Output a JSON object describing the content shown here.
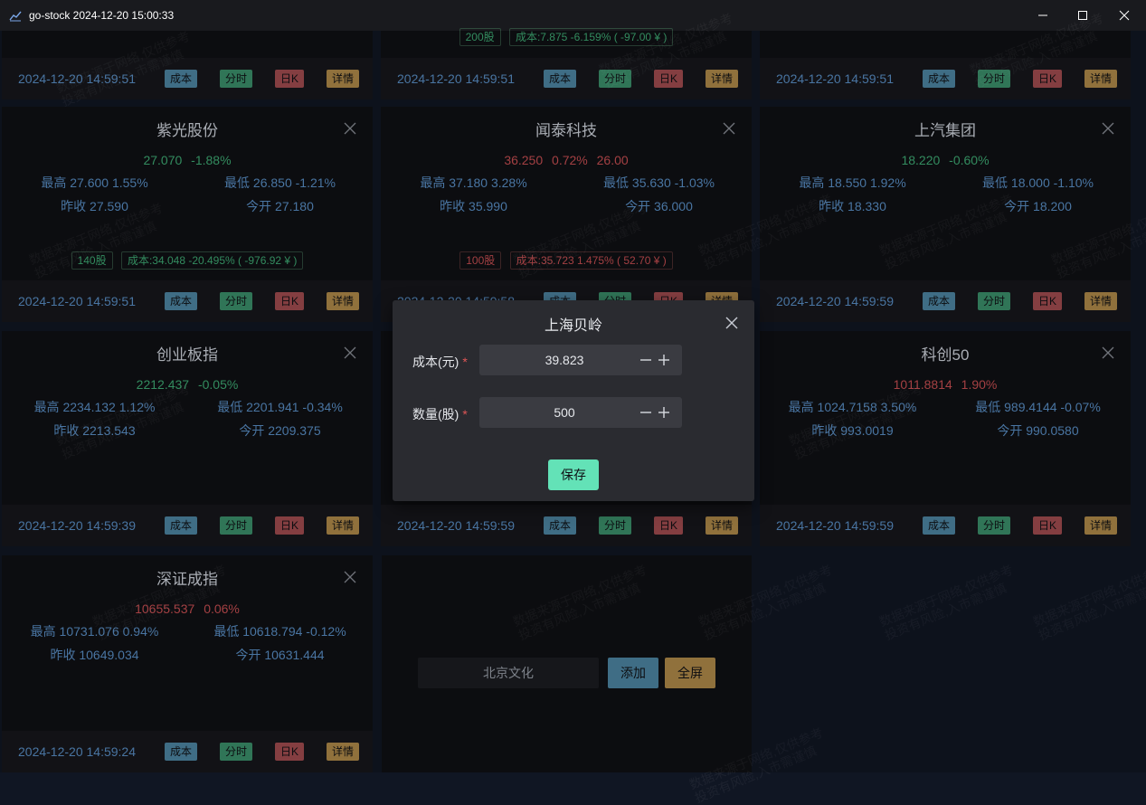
{
  "window": {
    "title": "go-stock 2024-12-20 15:00:33"
  },
  "colors": {
    "up": "#c84f52",
    "down": "#3fab74",
    "accent_blue": "#5a8fc6"
  },
  "buttons": {
    "cost": "成本",
    "minute": "分时",
    "daily_k": "日K",
    "detail": "详情"
  },
  "top_row": {
    "times": [
      "2024-12-20 14:59:51",
      "2024-12-20 14:59:51",
      "2024-12-20 14:59:51"
    ],
    "middle_shares": "200股",
    "middle_cost": "成本:7.875 -6.159% ( -97.00 ¥ )"
  },
  "cards": [
    {
      "name": "紫光股份",
      "price": "27.070",
      "change": "-1.88%",
      "amount": "",
      "high": "最高 27.600 1.55%",
      "low": "最低 26.850 -1.21%",
      "prev_close": "昨收 27.590",
      "open": "今开 27.180",
      "shares": "140股",
      "cost_info": "成本:34.048 -20.495% ( -976.92 ¥ )",
      "time": "2024-12-20 14:59:51"
    },
    {
      "name": "闻泰科技",
      "price": "36.250",
      "change": "0.72%",
      "amount": "26.00",
      "high": "最高 37.180 3.28%",
      "low": "最低 35.630 -1.03%",
      "prev_close": "昨收 35.990",
      "open": "今开 36.000",
      "shares": "100股",
      "cost_info": "成本:35.723 1.475% ( 52.70 ¥ )",
      "time": "2024-12-20 14:59:58"
    },
    {
      "name": "上汽集团",
      "price": "18.220",
      "change": "-0.60%",
      "amount": "",
      "high": "最高 18.550 1.92%",
      "low": "最低 18.000 -1.10%",
      "prev_close": "昨收 18.330",
      "open": "今开 18.200",
      "time": "2024-12-20 14:59:59"
    },
    {
      "name": "创业板指",
      "price": "2212.437",
      "change": "-0.05%",
      "amount": "",
      "high": "最高 2234.132 1.12%",
      "low": "最低 2201.941 -0.34%",
      "prev_close": "昨收 2213.543",
      "open": "今开 2209.375",
      "time": "2024-12-20 14:59:39"
    },
    {
      "time": "2024-12-20 14:59:59"
    },
    {
      "name": "科创50",
      "price": "1011.8814",
      "change": "1.90%",
      "amount": "",
      "high": "最高 1024.7158 3.50%",
      "low": "最低 989.4144 -0.07%",
      "prev_close": "昨收 993.0019",
      "open": "今开 990.0580",
      "time": "2024-12-20 14:59:59"
    },
    {
      "name": "深证成指",
      "price": "10655.537",
      "change": "0.06%",
      "amount": "",
      "high": "最高 10731.076 0.94%",
      "low": "最低 10618.794 -0.12%",
      "prev_close": "昨收 10649.034",
      "open": "今开 10631.444",
      "time": "2024-12-20 14:59:24"
    }
  ],
  "add_panel": {
    "input_value": "北京文化",
    "add_label": "添加",
    "fullscreen_label": "全屏"
  },
  "modal": {
    "title": "上海贝岭",
    "cost_label": "成本(元)",
    "cost_value": "39.823",
    "qty_label": "数量(股)",
    "qty_value": "500",
    "required_mark": "*",
    "save_label": "保存"
  },
  "watermark": {
    "line1": "数据来源于网络,仅供参考",
    "line2": "投资有风险,入市需谨慎"
  }
}
